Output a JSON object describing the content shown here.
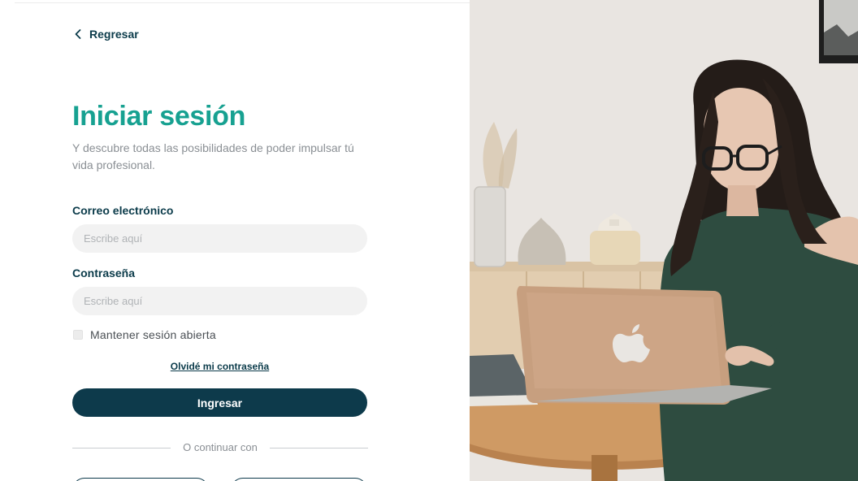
{
  "back": {
    "label": "Regresar"
  },
  "header": {
    "title": "Iniciar sesión",
    "subtitle": "Y descubre todas las posibilidades de poder impulsar tú vida profesional."
  },
  "form": {
    "email": {
      "label": "Correo electrónico",
      "placeholder": "Escribe aquí",
      "value": ""
    },
    "password": {
      "label": "Contraseña",
      "placeholder": "Escribe aquí",
      "value": ""
    },
    "remember": {
      "label": "Mantener sesión abierta",
      "checked": false
    },
    "forgot_label": "Olvidé mi contraseña",
    "submit_label": "Ingresar"
  },
  "divider": {
    "text": "O continuar con"
  },
  "colors": {
    "accent": "#17a191",
    "primary": "#0d3a4b",
    "text_dark": "#0b3b4a",
    "muted": "#8a8f94",
    "input_bg": "#f2f2f2"
  },
  "icons": {
    "back": "chevron-left-icon"
  }
}
